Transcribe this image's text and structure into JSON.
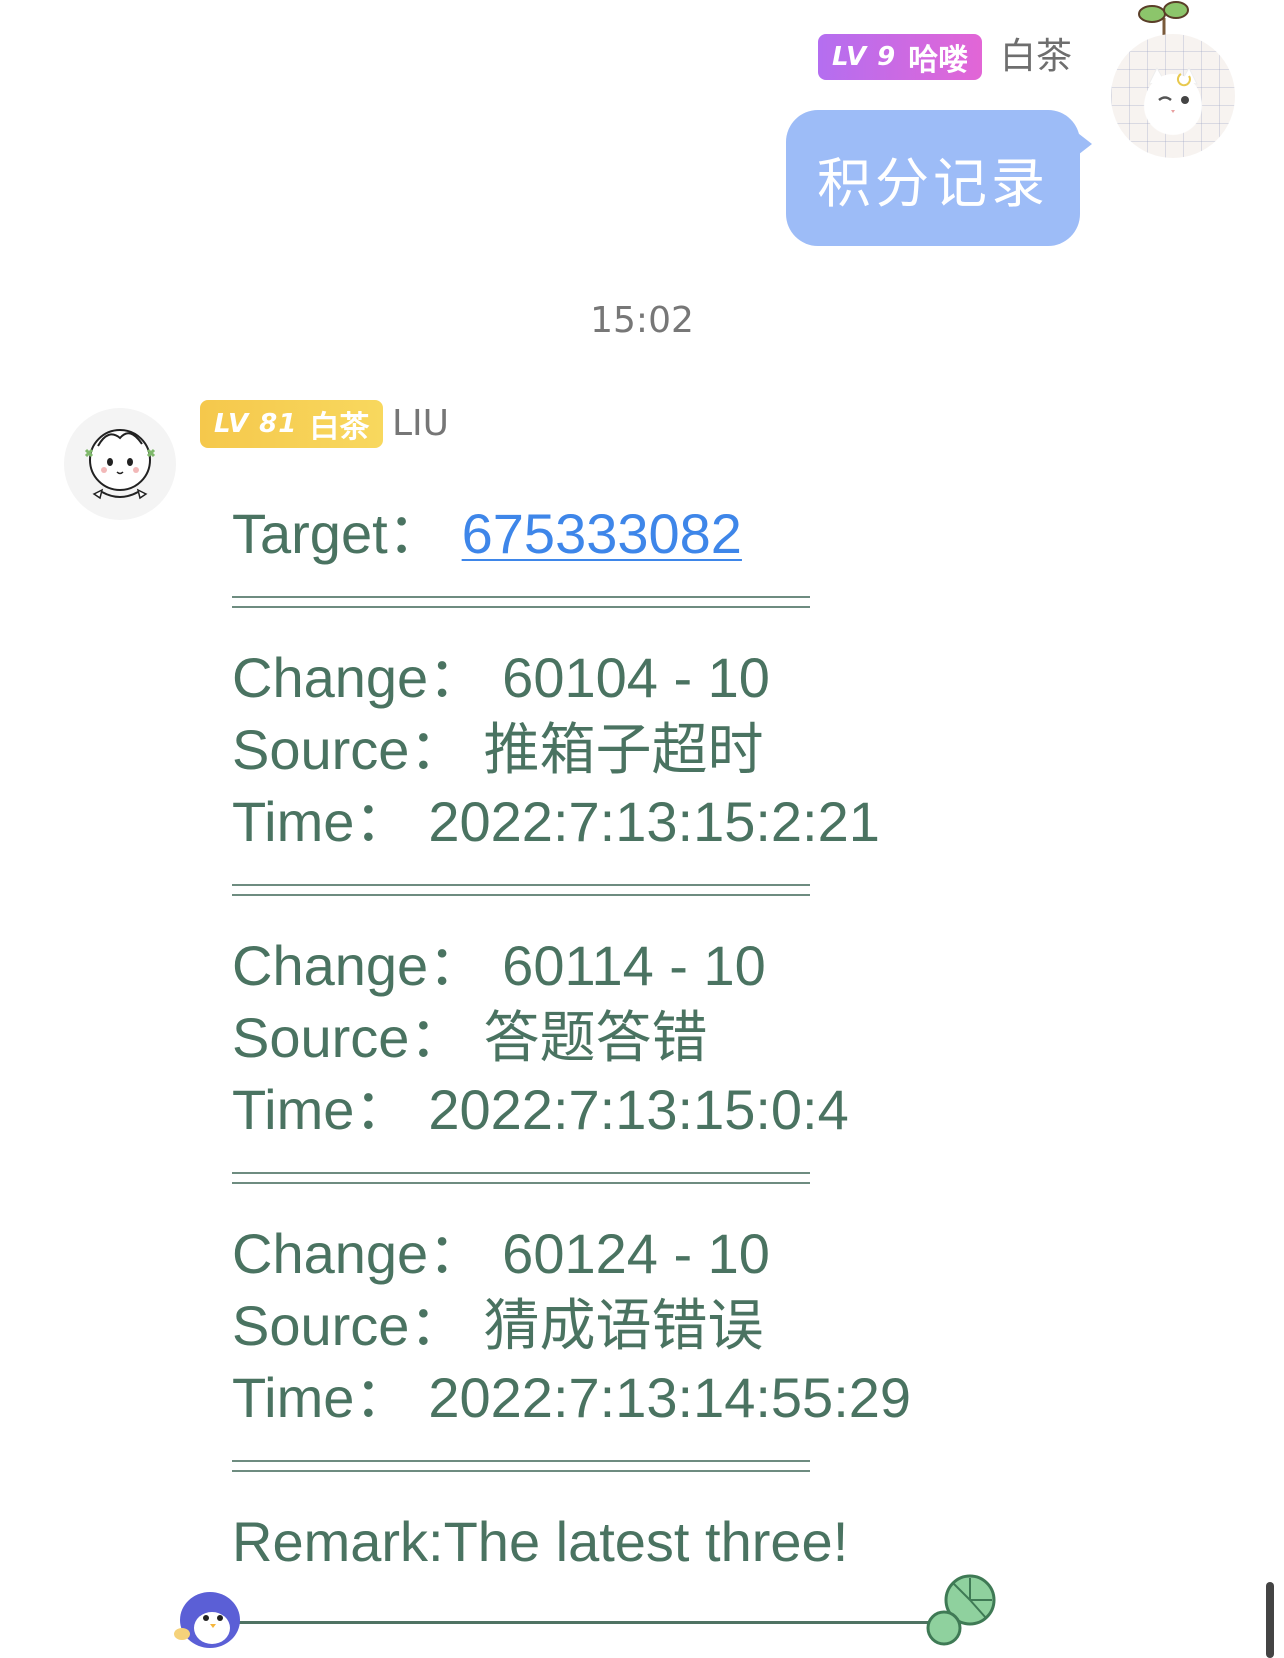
{
  "outgoing": {
    "level": "LV 9",
    "title": "哈喽",
    "name": "白茶",
    "message": "积分记录",
    "avatar_icon": "white-cat-avatar",
    "decoration_icon": "sprout-icon",
    "badge_colors": [
      "#b46ef0",
      "#e266d6"
    ],
    "bubble_color": "#9dbcf7"
  },
  "timestamp": "15:02",
  "incoming": {
    "level": "LV 81",
    "title": "白茶",
    "name": "LIU",
    "avatar_icon": "cartoon-boy-avatar",
    "badge_colors": [
      "#f5c84c",
      "#f8d85e"
    ],
    "target_label": "Target：",
    "target_value": "675333082",
    "records": [
      {
        "change_label": "Change：",
        "change_value": "60104 - 10",
        "source_label": "Source：",
        "source_value": "推箱子超时",
        "time_label": "Time：",
        "time_value": "2022:7:13:15:2:21"
      },
      {
        "change_label": "Change：",
        "change_value": "60114 - 10",
        "source_label": "Source：",
        "source_value": "答题答错",
        "time_label": "Time：",
        "time_value": "2022:7:13:15:0:4"
      },
      {
        "change_label": "Change：",
        "change_value": "60124 - 10",
        "source_label": "Source：",
        "source_value": "猜成语错误",
        "time_label": "Time：",
        "time_value": "2022:7:13:14:55:29"
      }
    ],
    "remark": "Remark:The latest three!",
    "text_color": "#4a7361",
    "link_color": "#3e86e9",
    "decorations": [
      "penguin-icon",
      "lotus-leaf-icon"
    ]
  }
}
